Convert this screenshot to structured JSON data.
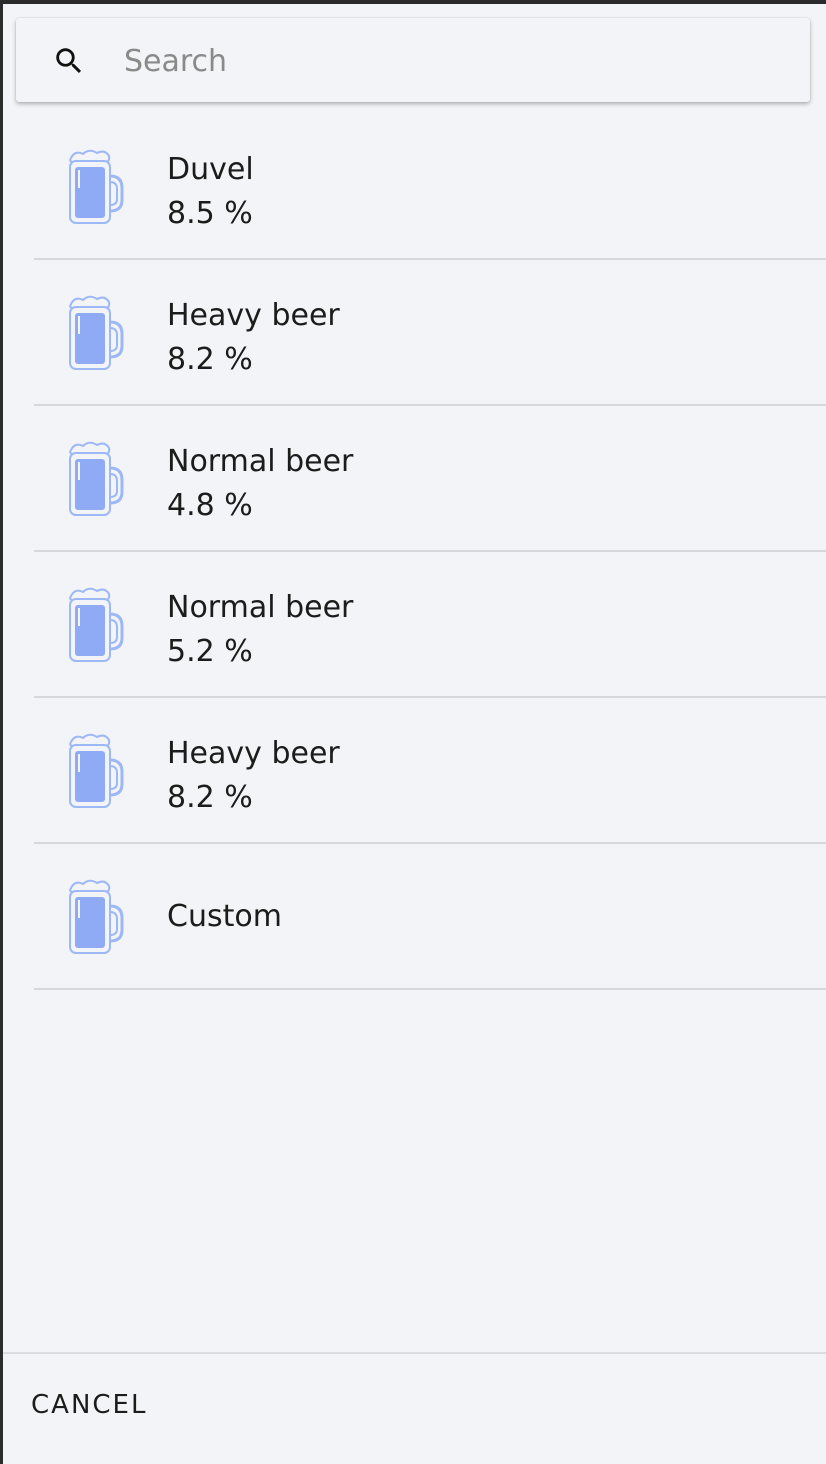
{
  "search": {
    "placeholder": "Search",
    "value": "",
    "icon": "search-icon"
  },
  "drinks": [
    {
      "name": "Duvel",
      "abv": "8.5 %",
      "icon": "beer-mug-icon"
    },
    {
      "name": "Heavy beer",
      "abv": "8.2 %",
      "icon": "beer-mug-icon"
    },
    {
      "name": "Normal beer",
      "abv": "4.8 %",
      "icon": "beer-mug-icon"
    },
    {
      "name": "Normal beer",
      "abv": "5.2 %",
      "icon": "beer-mug-icon"
    },
    {
      "name": "Heavy beer",
      "abv": "8.2 %",
      "icon": "beer-mug-icon"
    },
    {
      "name": "Custom",
      "abv": "",
      "icon": "beer-mug-icon"
    }
  ],
  "footer": {
    "cancel_label": "CANCEL"
  },
  "colors": {
    "background": "#f3f4f7",
    "mug_fill": "#8fabf5",
    "mug_outline": "#9db8f7",
    "divider": "#d7d8db"
  }
}
